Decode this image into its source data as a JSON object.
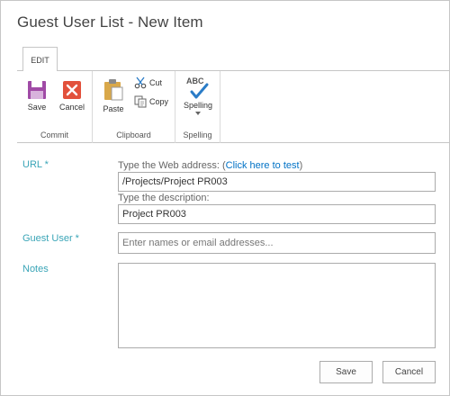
{
  "title": "Guest User List - New Item",
  "ribbon": {
    "tab": "EDIT",
    "groups": {
      "commit": {
        "label": "Commit",
        "save": "Save",
        "cancel": "Cancel"
      },
      "clipboard": {
        "label": "Clipboard",
        "paste": "Paste",
        "cut": "Cut",
        "copy": "Copy"
      },
      "spelling": {
        "label": "Spelling",
        "button": "Spelling",
        "abc": "ABC"
      }
    }
  },
  "form": {
    "url": {
      "label": "URL *",
      "address_hint_prefix": "Type the Web address: (",
      "address_hint_link": "Click here to test",
      "address_hint_suffix": ")",
      "address_value": "/Projects/Project PR003",
      "description_hint": "Type the description:",
      "description_value": "Project PR003"
    },
    "guest_user": {
      "label": "Guest User *",
      "placeholder": "Enter names or email addresses..."
    },
    "notes": {
      "label": "Notes",
      "value": ""
    }
  },
  "buttons": {
    "save": "Save",
    "cancel": "Cancel"
  },
  "colors": {
    "accent": "#3aa5b7",
    "link": "#0072c6",
    "save_icon": "#a04ba6",
    "cancel_icon": "#e2513b",
    "check": "#2a7cc7"
  },
  "icons": [
    "save-icon",
    "cancel-icon",
    "paste-icon",
    "cut-icon",
    "copy-icon",
    "spelling-icon",
    "dropdown-arrow-icon"
  ]
}
